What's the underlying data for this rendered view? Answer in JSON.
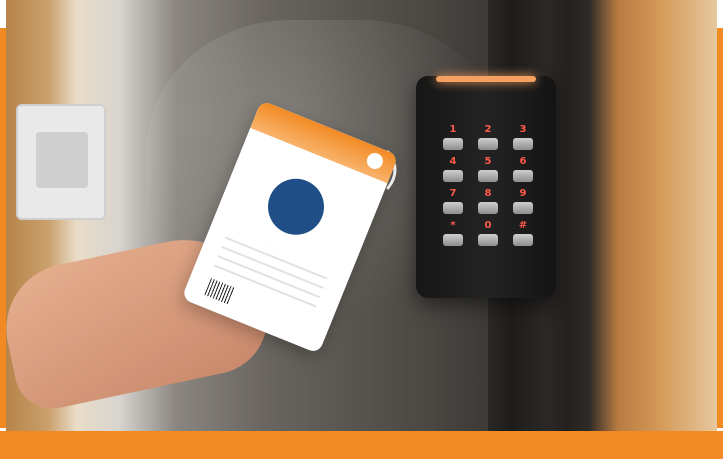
{
  "keypad": {
    "keys": [
      "1",
      "2",
      "3",
      "4",
      "5",
      "6",
      "7",
      "8",
      "9",
      "*",
      "0",
      "#"
    ]
  },
  "colors": {
    "accent_orange": "#f28a24",
    "led_orange": "#f4a060",
    "key_digit_red": "#ff5a4a"
  },
  "icons": {
    "nfc_signal": "nfc-signal-icon"
  }
}
